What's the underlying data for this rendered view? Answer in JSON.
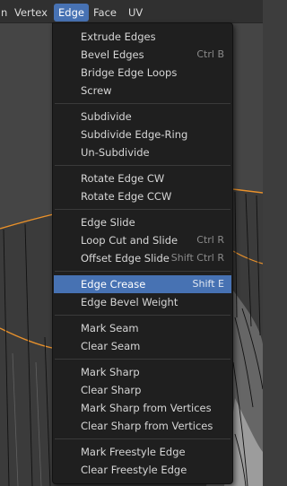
{
  "menubar": {
    "tabs": [
      {
        "label": "n"
      },
      {
        "label": "Vertex"
      },
      {
        "label": "Edge"
      },
      {
        "label": "Face"
      },
      {
        "label": "UV"
      }
    ],
    "active_tab": "Edge"
  },
  "edge_menu": {
    "groups": [
      [
        {
          "label": "Extrude Edges",
          "shortcut": ""
        },
        {
          "label": "Bevel Edges",
          "shortcut": "Ctrl B"
        },
        {
          "label": "Bridge Edge Loops",
          "shortcut": ""
        },
        {
          "label": "Screw",
          "shortcut": ""
        }
      ],
      [
        {
          "label": "Subdivide",
          "shortcut": ""
        },
        {
          "label": "Subdivide Edge-Ring",
          "shortcut": ""
        },
        {
          "label": "Un-Subdivide",
          "shortcut": ""
        }
      ],
      [
        {
          "label": "Rotate Edge CW",
          "shortcut": ""
        },
        {
          "label": "Rotate Edge CCW",
          "shortcut": ""
        }
      ],
      [
        {
          "label": "Edge Slide",
          "shortcut": ""
        },
        {
          "label": "Loop Cut and Slide",
          "shortcut": "Ctrl R"
        },
        {
          "label": "Offset Edge Slide",
          "shortcut": "Shift Ctrl R"
        }
      ],
      [
        {
          "label": "Edge Crease",
          "shortcut": "Shift E",
          "highlighted": true
        },
        {
          "label": "Edge Bevel Weight",
          "shortcut": ""
        }
      ],
      [
        {
          "label": "Mark Seam",
          "shortcut": ""
        },
        {
          "label": "Clear Seam",
          "shortcut": ""
        }
      ],
      [
        {
          "label": "Mark Sharp",
          "shortcut": ""
        },
        {
          "label": "Clear Sharp",
          "shortcut": ""
        },
        {
          "label": "Mark Sharp from Vertices",
          "shortcut": ""
        },
        {
          "label": "Clear Sharp from Vertices",
          "shortcut": ""
        }
      ],
      [
        {
          "label": "Mark Freestyle Edge",
          "shortcut": ""
        },
        {
          "label": "Clear Freestyle Edge",
          "shortcut": ""
        }
      ]
    ]
  },
  "colors": {
    "accent": "#4772b3",
    "menu_bg": "#1f1f1f",
    "header_bg": "#303030",
    "viewport_bg": "#3f3f3f",
    "selection_outline": "#e8912c"
  }
}
